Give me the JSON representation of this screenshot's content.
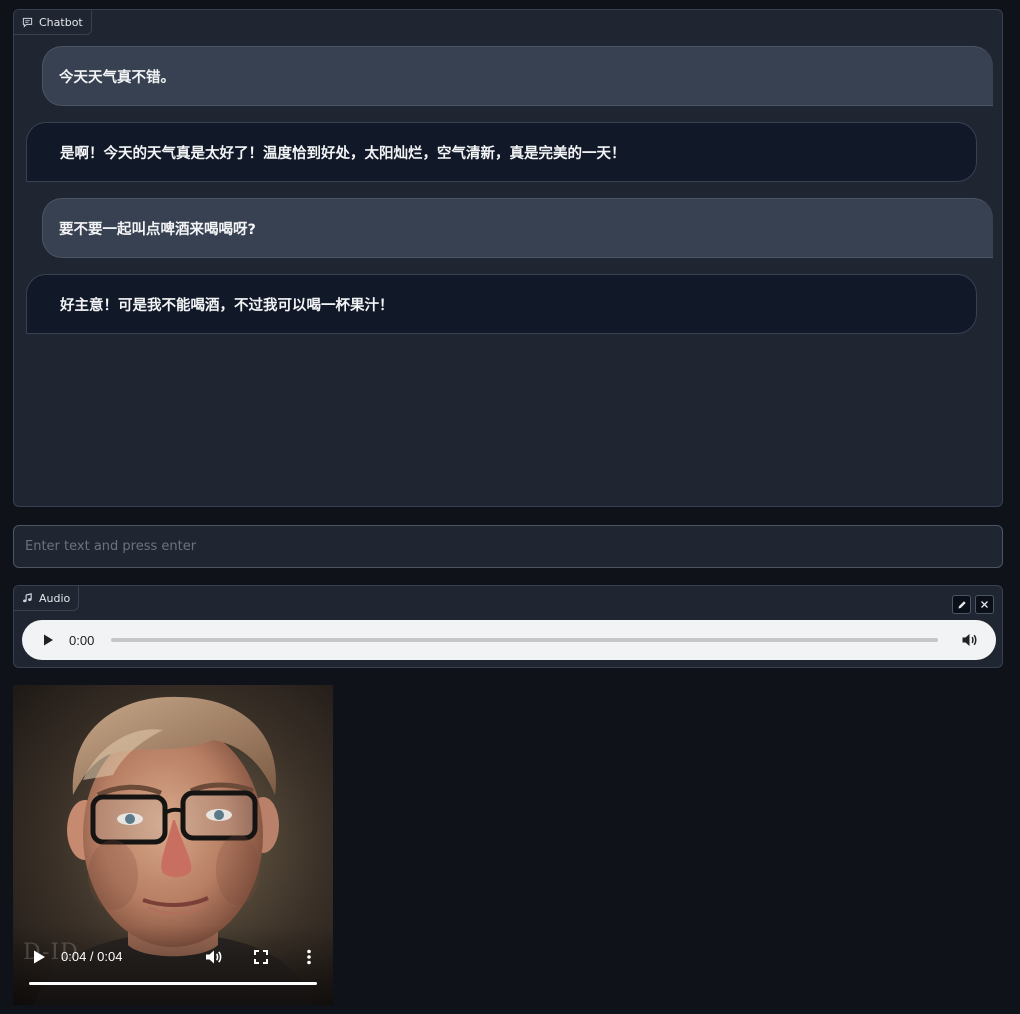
{
  "chatbot": {
    "label": "Chatbot",
    "messages": [
      {
        "role": "user",
        "text": "今天天气真不错。"
      },
      {
        "role": "bot",
        "text": "是啊！今天的天气真是太好了！温度恰到好处，太阳灿烂，空气清新，真是完美的一天！"
      },
      {
        "role": "user",
        "text": "要不要一起叫点啤酒来喝喝呀?"
      },
      {
        "role": "bot",
        "text": "好主意！可是我不能喝酒，不过我可以喝一杯果汁！"
      }
    ]
  },
  "text_input": {
    "placeholder": "Enter text and press enter",
    "value": ""
  },
  "audio": {
    "label": "Audio",
    "time": "0:00",
    "edit_icon": "pencil-icon",
    "clear_icon": "close-icon"
  },
  "video": {
    "time": "0:04 / 0:04",
    "progress": 1.0,
    "watermark": "D-ID"
  },
  "colors": {
    "background": "#0f1219",
    "panel": "#1f2631",
    "user_bubble": "#374151",
    "bot_bubble": "#111827"
  }
}
